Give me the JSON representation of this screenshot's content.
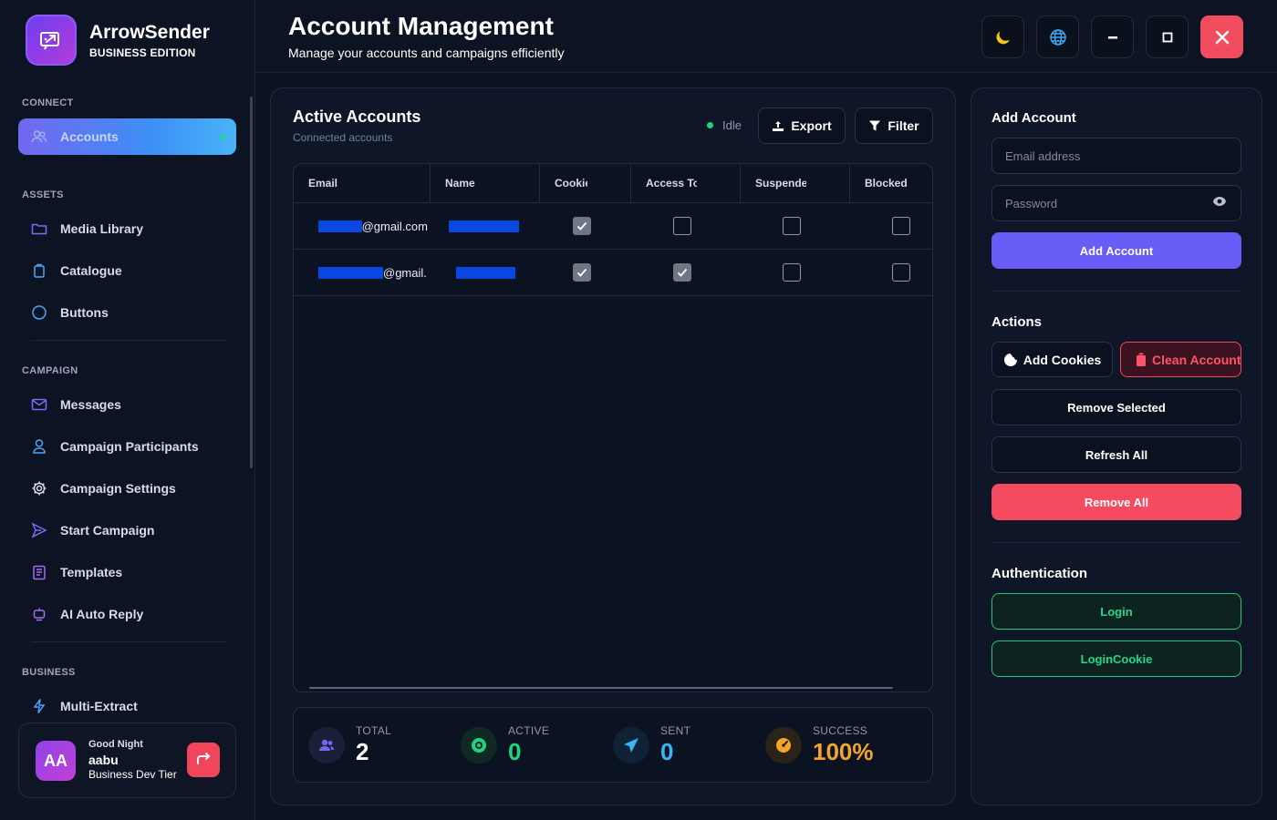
{
  "brand": {
    "name": "ArrowSender",
    "edition": "BUSINESS EDITION"
  },
  "sidebar": {
    "sections": {
      "connect": "CONNECT",
      "assets": "ASSETS",
      "campaign": "CAMPAIGN",
      "business": "BUSINESS"
    },
    "items": {
      "accounts": "Accounts",
      "media_library": "Media Library",
      "catalogue": "Catalogue",
      "buttons": "Buttons",
      "messages": "Messages",
      "campaign_participants": "Campaign Participants",
      "campaign_settings": "Campaign Settings",
      "start_campaign": "Start Campaign",
      "templates": "Templates",
      "ai_auto_reply": "AI Auto Reply",
      "multi_extract": "Multi-Extract"
    },
    "active_item": "accounts"
  },
  "user": {
    "initials": "AA",
    "greeting": "Good Night",
    "name": "aabu",
    "tier": "Business Dev Tier"
  },
  "header": {
    "title": "Account Management",
    "subtitle": "Manage your accounts and campaigns efficiently"
  },
  "accounts_panel": {
    "title": "Active Accounts",
    "subtitle": "Connected accounts",
    "status": "Idle",
    "export_label": "Export",
    "filter_label": "Filter",
    "columns": [
      "Email",
      "Name",
      "Cookies",
      "Access Token",
      "Suspended",
      "Blocked"
    ],
    "rows": [
      {
        "email_suffix": "@gmail.com",
        "cookies": true,
        "access_token": false,
        "suspended": false,
        "blocked": false
      },
      {
        "email_suffix": "@gmail.",
        "cookies": true,
        "access_token": true,
        "suspended": false,
        "blocked": false
      }
    ]
  },
  "stats": {
    "total": {
      "label": "TOTAL",
      "value": "2"
    },
    "active": {
      "label": "ACTIVE",
      "value": "0"
    },
    "sent": {
      "label": "SENT",
      "value": "0"
    },
    "success": {
      "label": "SUCCESS",
      "value": "100%"
    }
  },
  "add_account": {
    "title": "Add Account",
    "email_placeholder": "Email address",
    "password_placeholder": "Password",
    "button": "Add Account"
  },
  "actions": {
    "title": "Actions",
    "add_cookies": "Add Cookies",
    "clean_account": "Clean Account",
    "remove_selected": "Remove Selected",
    "refresh_all": "Refresh All",
    "remove_all": "Remove All"
  },
  "authentication": {
    "title": "Authentication",
    "login": "Login",
    "login_cookie": "LoginCookie"
  },
  "colors": {
    "accent": "#6a5cf6",
    "danger": "#f64a60",
    "success": "#22d889",
    "stat_total": "#7367f0",
    "stat_active": "#1fd47d",
    "stat_sent": "#38b6f5",
    "stat_success": "#f4a428"
  }
}
